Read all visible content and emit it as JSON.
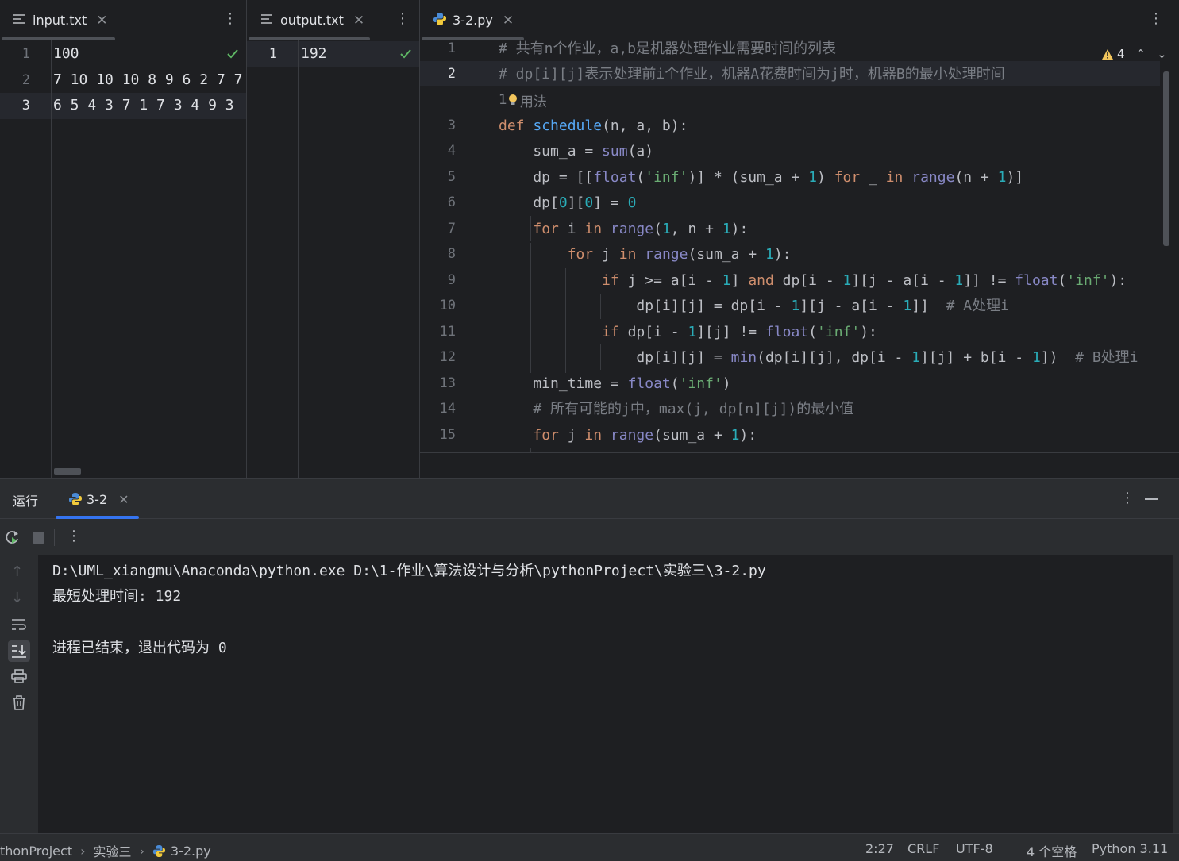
{
  "panes": {
    "input": {
      "tab_label": "input.txt",
      "lines": [
        "100",
        "7 10 10 10 8 9 6 2 7 7",
        "6 5 4 3 7 1 7 3 4 9 3"
      ],
      "line_numbers": [
        "1",
        "2",
        "3"
      ]
    },
    "output": {
      "tab_label": "output.txt",
      "lines": [
        "192"
      ],
      "line_numbers": [
        "1"
      ]
    },
    "editor": {
      "tab_label": "3-2.py",
      "warning_count": "4",
      "usage_hint": "1",
      "usage_label": "用法",
      "line_numbers": [
        "1",
        "2",
        "3",
        "4",
        "5",
        "6",
        "7",
        "8",
        "9",
        "10",
        "11",
        "12",
        "13",
        "14",
        "15"
      ],
      "code": [
        [
          [
            "cm",
            "# 共有n个作业，a,b是机器处理作业需要时间的列表"
          ]
        ],
        [
          [
            "cm",
            "# dp[i][j]表示处理前i个作业，机器A花费时间为j时，机器B的最小处理时间"
          ]
        ],
        [
          [
            "kw",
            "def "
          ],
          [
            "fn",
            "schedule"
          ],
          [
            "",
            "(n, a, b):"
          ]
        ],
        [
          [
            "",
            "    sum_a = "
          ],
          [
            "bi",
            "sum"
          ],
          [
            "",
            "(a)"
          ]
        ],
        [
          [
            "",
            "    dp = [["
          ],
          [
            "bi",
            "float"
          ],
          [
            "",
            "("
          ],
          [
            "str",
            "'inf'"
          ],
          [
            "",
            ")] * (sum_a + "
          ],
          [
            "num",
            "1"
          ],
          [
            "",
            ") "
          ],
          [
            "kw",
            "for"
          ],
          [
            "",
            " _ "
          ],
          [
            "kw",
            "in"
          ],
          [
            "",
            " "
          ],
          [
            "bi",
            "range"
          ],
          [
            "",
            "(n + "
          ],
          [
            "num",
            "1"
          ],
          [
            "",
            ")]"
          ]
        ],
        [
          [
            "",
            "    dp["
          ],
          [
            "num",
            "0"
          ],
          [
            "",
            "]["
          ],
          [
            "num",
            "0"
          ],
          [
            "",
            "] = "
          ],
          [
            "num",
            "0"
          ]
        ],
        [
          [
            "",
            "    "
          ],
          [
            "kw",
            "for"
          ],
          [
            "",
            " i "
          ],
          [
            "kw",
            "in"
          ],
          [
            "",
            " "
          ],
          [
            "bi",
            "range"
          ],
          [
            "",
            "("
          ],
          [
            "num",
            "1"
          ],
          [
            "",
            ", n + "
          ],
          [
            "num",
            "1"
          ],
          [
            "",
            "):"
          ]
        ],
        [
          [
            "",
            "        "
          ],
          [
            "kw",
            "for"
          ],
          [
            "",
            " j "
          ],
          [
            "kw",
            "in"
          ],
          [
            "",
            " "
          ],
          [
            "bi",
            "range"
          ],
          [
            "",
            "(sum_a + "
          ],
          [
            "num",
            "1"
          ],
          [
            "",
            "):"
          ]
        ],
        [
          [
            "",
            "            "
          ],
          [
            "kw",
            "if"
          ],
          [
            "",
            " j >= a[i - "
          ],
          [
            "num",
            "1"
          ],
          [
            "",
            "] "
          ],
          [
            "kw",
            "and"
          ],
          [
            "",
            " dp[i - "
          ],
          [
            "num",
            "1"
          ],
          [
            "",
            "][j - a[i - "
          ],
          [
            "num",
            "1"
          ],
          [
            "",
            "]] != "
          ],
          [
            "bi",
            "float"
          ],
          [
            "",
            "("
          ],
          [
            "str",
            "'inf'"
          ],
          [
            "",
            "):"
          ]
        ],
        [
          [
            "",
            "                dp[i][j] = dp[i - "
          ],
          [
            "num",
            "1"
          ],
          [
            "",
            "][j - a[i - "
          ],
          [
            "num",
            "1"
          ],
          [
            "",
            "]]  "
          ],
          [
            "cm",
            "# A处理i"
          ]
        ],
        [
          [
            "",
            "            "
          ],
          [
            "kw",
            "if"
          ],
          [
            "",
            " dp[i - "
          ],
          [
            "num",
            "1"
          ],
          [
            "",
            "][j] != "
          ],
          [
            "bi",
            "float"
          ],
          [
            "",
            "("
          ],
          [
            "str",
            "'inf'"
          ],
          [
            "",
            "):"
          ]
        ],
        [
          [
            "",
            "                dp[i][j] = "
          ],
          [
            "bi",
            "min"
          ],
          [
            "",
            "(dp[i][j], dp[i - "
          ],
          [
            "num",
            "1"
          ],
          [
            "",
            "][j] + b[i - "
          ],
          [
            "num",
            "1"
          ],
          [
            "",
            "])  "
          ],
          [
            "cm",
            "# B处理i"
          ]
        ],
        [
          [
            "",
            "    min_time = "
          ],
          [
            "bi",
            "float"
          ],
          [
            "",
            "("
          ],
          [
            "str",
            "'inf'"
          ],
          [
            "",
            ")"
          ]
        ],
        [
          [
            "",
            "    "
          ],
          [
            "cm",
            "# 所有可能的j中，max(j, dp[n][j])的最小值"
          ]
        ],
        [
          [
            "",
            "    "
          ],
          [
            "kw",
            "for"
          ],
          [
            "",
            " j "
          ],
          [
            "kw",
            "in"
          ],
          [
            "",
            " "
          ],
          [
            "bi",
            "range"
          ],
          [
            "",
            "(sum_a + "
          ],
          [
            "num",
            "1"
          ],
          [
            "",
            "):"
          ]
        ]
      ]
    }
  },
  "run_panel": {
    "title": "运行",
    "tab_label": "3-2",
    "console_lines": [
      "D:\\UML_xiangmu\\Anaconda\\python.exe D:\\1-作业\\算法设计与分析\\pythonProject\\实验三\\3-2.py",
      "最短处理时间: 192",
      "",
      "进程已结束，退出代码为 0"
    ]
  },
  "status_bar": {
    "breadcrumb": [
      "thonProject",
      "实验三",
      "3-2.py"
    ],
    "position": "2:27",
    "line_ending": "CRLF",
    "encoding": "UTF-8",
    "indent": "4 个空格",
    "interpreter": "Python 3.11"
  },
  "colors": {
    "accent": "#3574f0",
    "check": "#5fb865",
    "warning": "#f2c55c"
  }
}
